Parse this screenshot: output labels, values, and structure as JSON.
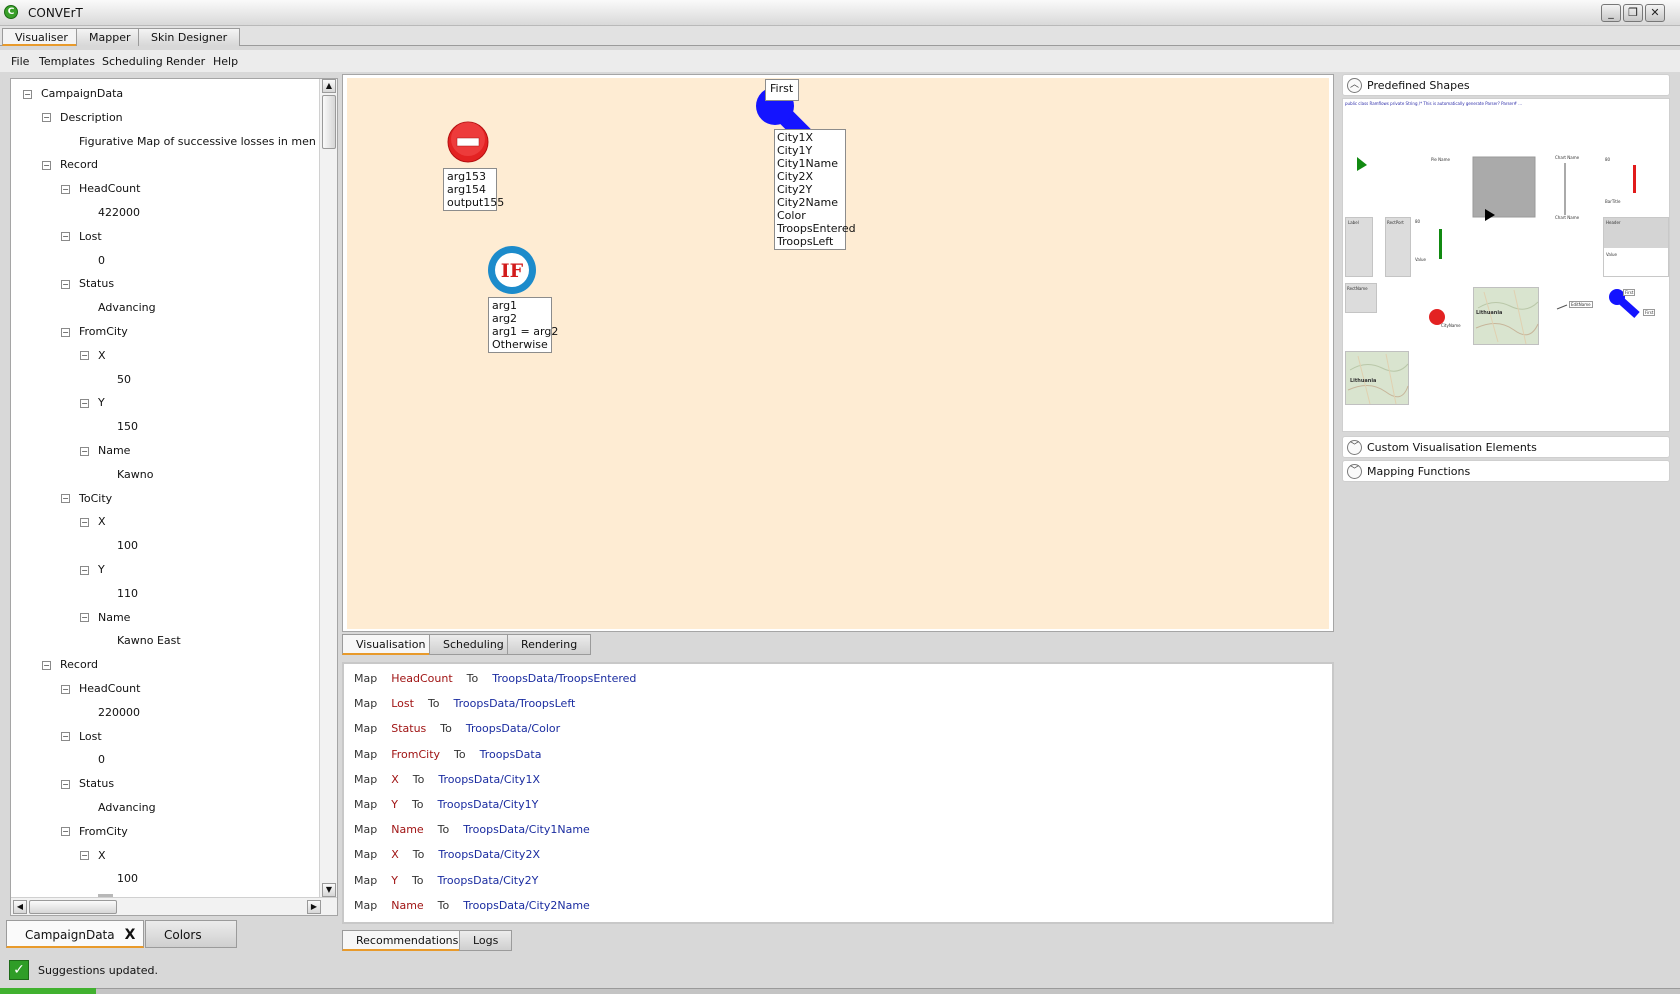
{
  "window": {
    "title": "CONVErT",
    "minimize": "_",
    "restore": "❐",
    "close": "✕"
  },
  "main_tabs": [
    "Visualiser",
    "Mapper",
    "Skin Designer"
  ],
  "menu": [
    "File",
    "Templates",
    "Scheduling",
    "Render",
    "Help"
  ],
  "tree": [
    {
      "label": "CampaignData",
      "level": 0,
      "toggle": true
    },
    {
      "label": "Description",
      "level": 1,
      "toggle": true
    },
    {
      "label": "Figurative Map of successive losses in men of the",
      "level": 2,
      "toggle": false
    },
    {
      "label": "Record",
      "level": 1,
      "toggle": true
    },
    {
      "label": "HeadCount",
      "level": 2,
      "toggle": true
    },
    {
      "label": "422000",
      "level": 3,
      "toggle": false
    },
    {
      "label": "Lost",
      "level": 2,
      "toggle": true
    },
    {
      "label": "0",
      "level": 3,
      "toggle": false
    },
    {
      "label": "Status",
      "level": 2,
      "toggle": true
    },
    {
      "label": "Advancing",
      "level": 3,
      "toggle": false
    },
    {
      "label": "FromCity",
      "level": 2,
      "toggle": true
    },
    {
      "label": "X",
      "level": 3,
      "toggle": true
    },
    {
      "label": "50",
      "level": 4,
      "toggle": false
    },
    {
      "label": "Y",
      "level": 3,
      "toggle": true
    },
    {
      "label": "150",
      "level": 4,
      "toggle": false
    },
    {
      "label": "Name",
      "level": 3,
      "toggle": true
    },
    {
      "label": "Kawno",
      "level": 4,
      "toggle": false
    },
    {
      "label": "ToCity",
      "level": 2,
      "toggle": true
    },
    {
      "label": "X",
      "level": 3,
      "toggle": true
    },
    {
      "label": "100",
      "level": 4,
      "toggle": false
    },
    {
      "label": "Y",
      "level": 3,
      "toggle": true
    },
    {
      "label": "110",
      "level": 4,
      "toggle": false
    },
    {
      "label": "Name",
      "level": 3,
      "toggle": true
    },
    {
      "label": "Kawno East",
      "level": 4,
      "toggle": false
    },
    {
      "label": "Record",
      "level": 1,
      "toggle": true
    },
    {
      "label": "HeadCount",
      "level": 2,
      "toggle": true
    },
    {
      "label": "220000",
      "level": 3,
      "toggle": false
    },
    {
      "label": "Lost",
      "level": 2,
      "toggle": true
    },
    {
      "label": "0",
      "level": 3,
      "toggle": false
    },
    {
      "label": "Status",
      "level": 2,
      "toggle": true
    },
    {
      "label": "Advancing",
      "level": 3,
      "toggle": false
    },
    {
      "label": "FromCity",
      "level": 2,
      "toggle": true
    },
    {
      "label": "X",
      "level": 3,
      "toggle": true
    },
    {
      "label": "100",
      "level": 4,
      "toggle": false
    },
    {
      "label": "Y",
      "level": 3,
      "toggle": true,
      "selected": true
    }
  ],
  "left_bottom_tabs": {
    "data_tab": "CampaignData",
    "close_x": "X",
    "colors_tab": "Colors"
  },
  "canvas": {
    "minus_args": [
      "arg153",
      "arg154",
      "output155"
    ],
    "if_args": [
      "arg1",
      "arg2",
      "arg1 = arg2",
      "Otherwise"
    ],
    "if_label": "IF",
    "first_label": "First",
    "troops_fields": [
      "City1X",
      "City1Y",
      "City1Name",
      "City2X",
      "City2Y",
      "City2Name",
      "Color",
      "TroopsEntered",
      "TroopsLeft"
    ]
  },
  "mid_tabs": [
    "Visualisation",
    "Scheduling",
    "Rendering"
  ],
  "recommendations": [
    {
      "map": "Map",
      "src": "HeadCount",
      "to": "To",
      "dst": "TroopsData/TroopsEntered"
    },
    {
      "map": "Map",
      "src": "Lost",
      "to": "To",
      "dst": "TroopsData/TroopsLeft"
    },
    {
      "map": "Map",
      "src": "Status",
      "to": "To",
      "dst": "TroopsData/Color"
    },
    {
      "map": "Map",
      "src": "FromCity",
      "to": "To",
      "dst": "TroopsData"
    },
    {
      "map": "Map",
      "src": "X",
      "to": "To",
      "dst": "TroopsData/City1X"
    },
    {
      "map": "Map",
      "src": "Y",
      "to": "To",
      "dst": "TroopsData/City1Y"
    },
    {
      "map": "Map",
      "src": "Name",
      "to": "To",
      "dst": "TroopsData/City1Name"
    },
    {
      "map": "Map",
      "src": "X",
      "to": "To",
      "dst": "TroopsData/City2X"
    },
    {
      "map": "Map",
      "src": "Y",
      "to": "To",
      "dst": "TroopsData/City2Y"
    },
    {
      "map": "Map",
      "src": "Name",
      "to": "To",
      "dst": "TroopsData/City2Name"
    }
  ],
  "bottom_tabs": [
    "Recommendations",
    "Logs"
  ],
  "palette": {
    "predefined": "Predefined Shapes",
    "custom": "Custom Visualisation Elements",
    "mapping": "Mapping Functions",
    "thumb_texts": {
      "code": "public class Ramflows private String   /* This is automatically generate Parser? Parser# ...",
      "pie_name": "Pie Name",
      "chart_name": "Chart Name",
      "chart_value": "Value",
      "bar_label": "Label",
      "bar_label2": "RectPort",
      "bar_value": "80",
      "bar_title": "BarTitle",
      "header": "Header",
      "value_lbl": "Value",
      "rect_name": "RectName",
      "city_name": "CityName",
      "map_label": "Lithuania",
      "edit_name": "EditName",
      "first": "First"
    }
  },
  "status": {
    "text": "Suggestions updated.",
    "icon": "check-icon"
  },
  "colors": {
    "canvas_bg": "#feecd3",
    "accent_tab": "#e89a2b",
    "map_src": "#a01414",
    "map_dst": "#1a2ca0",
    "minus_red": "#e32222",
    "if_blue": "#1c8bcb",
    "troops_blue": "#1414ff"
  }
}
